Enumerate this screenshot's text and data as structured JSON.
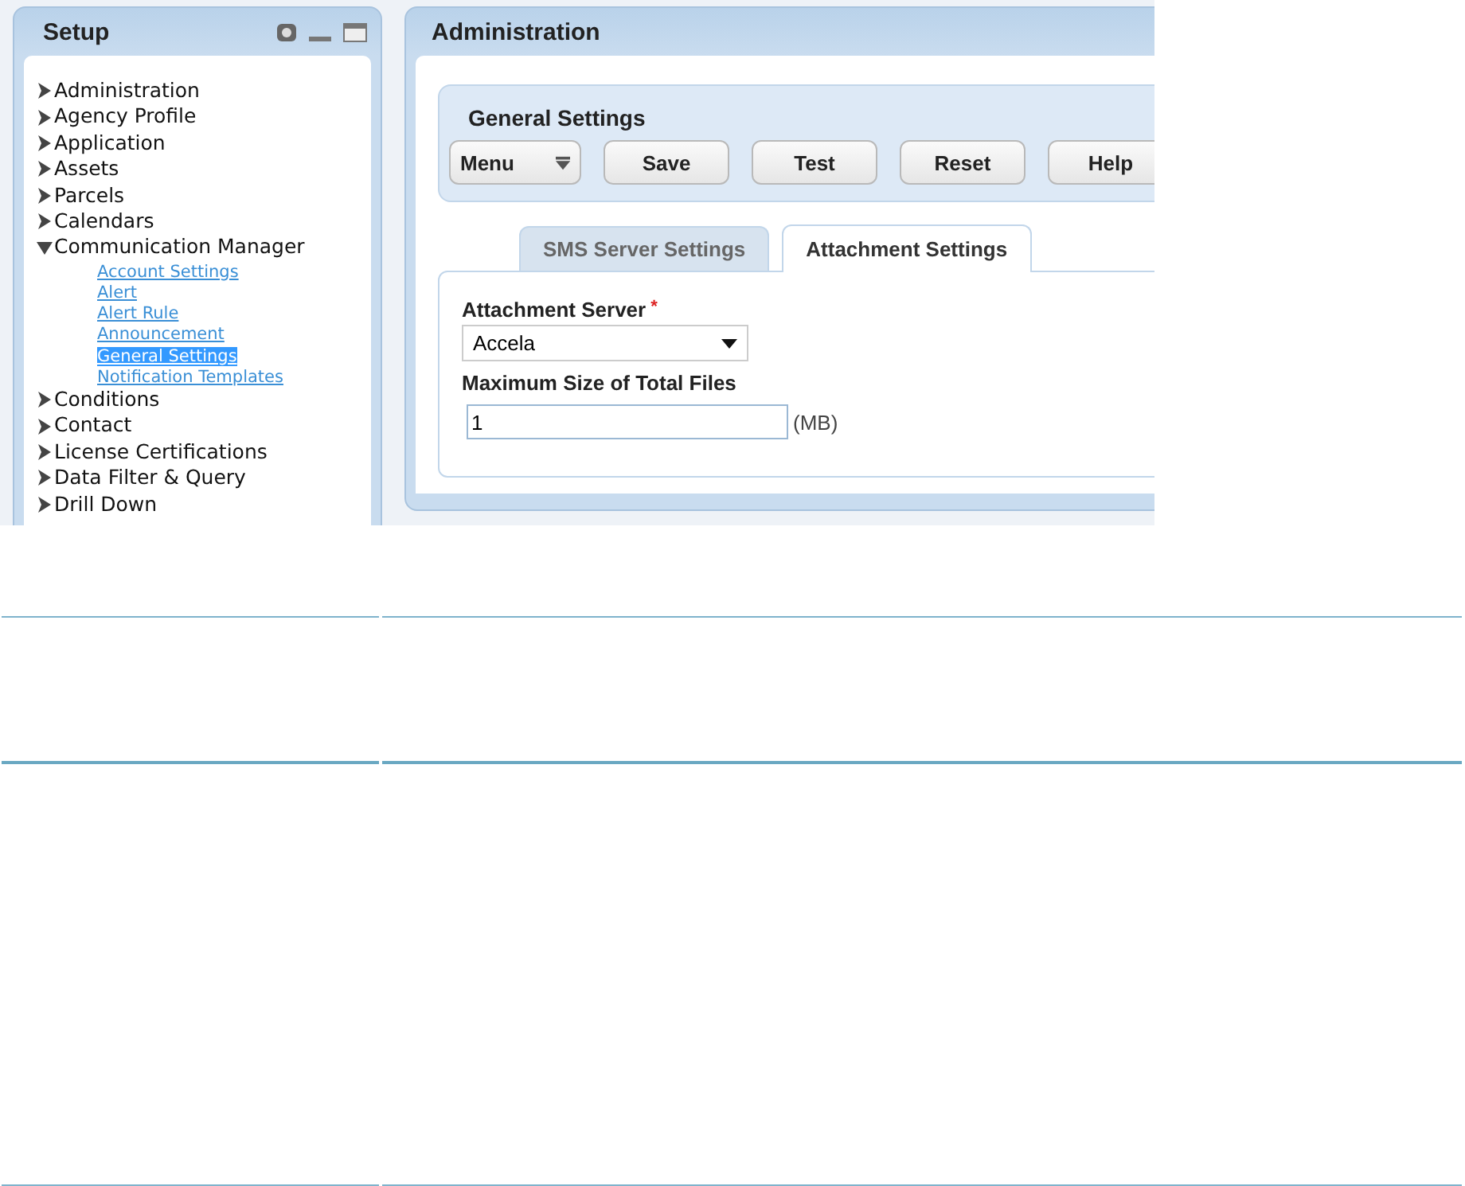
{
  "setup_panel": {
    "title": "Setup",
    "tree": [
      {
        "label": "Administration",
        "expanded": false
      },
      {
        "label": "Agency Profile",
        "expanded": false
      },
      {
        "label": "Application",
        "expanded": false
      },
      {
        "label": "Assets",
        "expanded": false
      },
      {
        "label": "Parcels",
        "expanded": false
      },
      {
        "label": "Calendars",
        "expanded": false
      },
      {
        "label": "Communication Manager",
        "expanded": true,
        "children": [
          {
            "label": "Account Settings",
            "selected": false
          },
          {
            "label": "Alert",
            "selected": false
          },
          {
            "label": "Alert Rule",
            "selected": false
          },
          {
            "label": "Announcement",
            "selected": false
          },
          {
            "label": "General Settings",
            "selected": true
          },
          {
            "label": "Notification Templates",
            "selected": false
          }
        ]
      },
      {
        "label": "Conditions",
        "expanded": false
      },
      {
        "label": "Contact",
        "expanded": false
      },
      {
        "label": "License Certifications",
        "expanded": false
      },
      {
        "label": "Data Filter & Query",
        "expanded": false
      },
      {
        "label": "Drill Down",
        "expanded": false
      }
    ]
  },
  "admin_panel": {
    "title": "Administration",
    "section_title": "General Settings",
    "buttons": [
      {
        "label": "Menu",
        "kind": "menu"
      },
      {
        "label": "Save",
        "kind": "plain"
      },
      {
        "label": "Test",
        "kind": "plain"
      },
      {
        "label": "Reset",
        "kind": "plain"
      },
      {
        "label": "Help",
        "kind": "plain"
      }
    ],
    "tabs": [
      {
        "label": "SMS Server Settings",
        "selected": false
      },
      {
        "label": "Attachment Settings",
        "selected": true
      }
    ],
    "attachment_server": {
      "label": "Attachment Server",
      "required_mark": "*",
      "value": "Accela"
    },
    "max_size": {
      "label": "Maximum Size of Total Files",
      "value": "1",
      "unit": "(MB)"
    }
  }
}
